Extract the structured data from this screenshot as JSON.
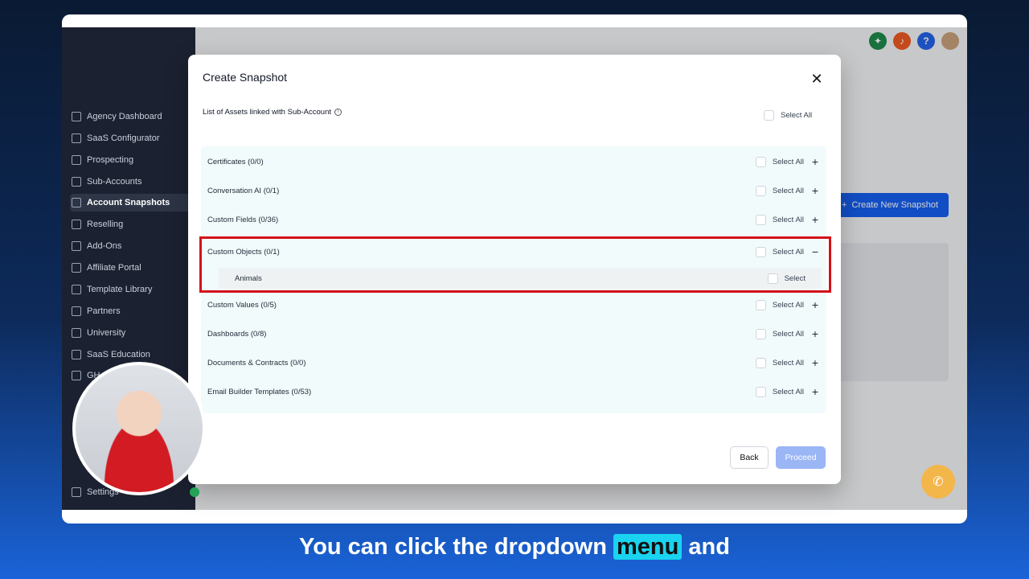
{
  "sidebar": {
    "items": [
      {
        "label": "Agency Dashboard",
        "active": false
      },
      {
        "label": "SaaS Configurator",
        "active": false
      },
      {
        "label": "Prospecting",
        "active": false
      },
      {
        "label": "Sub-Accounts",
        "active": false
      },
      {
        "label": "Account Snapshots",
        "active": true
      },
      {
        "label": "Reselling",
        "active": false
      },
      {
        "label": "Add-Ons",
        "active": false
      },
      {
        "label": "Affiliate Portal",
        "active": false
      },
      {
        "label": "Template Library",
        "active": false
      },
      {
        "label": "Partners",
        "active": false
      },
      {
        "label": "University",
        "active": false
      },
      {
        "label": "SaaS Education",
        "active": false
      },
      {
        "label": "GH",
        "active": false
      },
      {
        "label": "Settings",
        "active": false
      }
    ]
  },
  "background": {
    "create_button": "Create New Snapshot"
  },
  "modal": {
    "title": "Create Snapshot",
    "assets_label": "List of Assets linked with Sub-Account",
    "select_all": "Select All",
    "select": "Select",
    "rows": [
      {
        "label": "Certificates (0/0)",
        "expanded": false
      },
      {
        "label": "Conversation AI (0/1)",
        "expanded": false
      },
      {
        "label": "Custom Fields (0/36)",
        "expanded": false
      },
      {
        "label": "Custom Objects (0/1)",
        "expanded": true,
        "children": [
          {
            "label": "Animals"
          }
        ]
      },
      {
        "label": "Custom Values (0/5)",
        "expanded": false
      },
      {
        "label": "Dashboards (0/8)",
        "expanded": false
      },
      {
        "label": "Documents & Contracts (0/0)",
        "expanded": false
      },
      {
        "label": "Email Builder Templates (0/53)",
        "expanded": false
      }
    ],
    "back_label": "Back",
    "proceed_label": "Proceed"
  },
  "caption": {
    "before": "You can click the dropdown",
    "highlight": "menu",
    "after": "and"
  },
  "colors": {
    "accent": "#155eef",
    "highlight_border": "#d4111b",
    "caption_highlight": "#19d3f0"
  }
}
